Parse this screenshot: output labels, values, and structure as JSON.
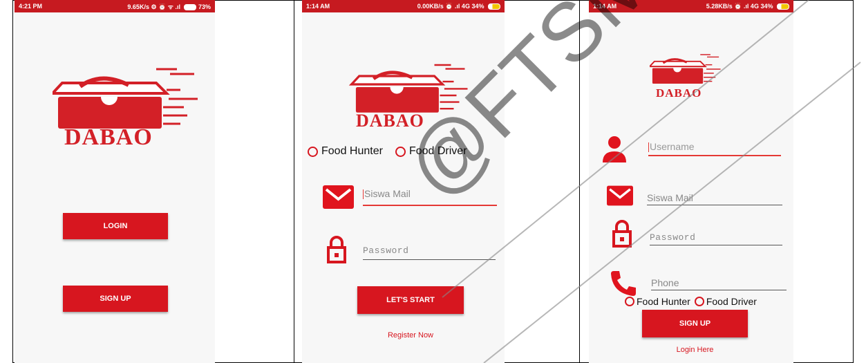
{
  "colors": {
    "accent": "#d7161f",
    "status_bar": "#c61a20",
    "panel_bg": "#f7f7f7"
  },
  "brand_name": "DABAO",
  "screens": [
    {
      "status": {
        "time": "4:21 PM",
        "right": "9.65K/s ⚙ ⏰ ᯤ .ıl",
        "battery": "73%"
      },
      "login_label": "LOGIN",
      "signup_label": "SIGN UP"
    },
    {
      "status": {
        "time": "1:14 AM",
        "right": "0.00KB/s ⏰ .ıl 4G",
        "battery": "34%"
      },
      "radio_hunter": "Food Hunter",
      "radio_driver": "Food Driver",
      "mail_placeholder": "Siswa Mail",
      "password_placeholder": "Password",
      "start_label": "LET'S START",
      "register_label": "Register Now"
    },
    {
      "status": {
        "time": "1:14 AM",
        "right": "5.28KB/s ⏰ .ıl 4G",
        "battery": "34%"
      },
      "username_placeholder": "Username",
      "mail_placeholder": "Siswa Mail",
      "password_placeholder": "Password",
      "phone_placeholder": "Phone",
      "radio_hunter": "Food Hunter",
      "radio_driver": "Food Driver",
      "signup_label": "SIGN UP",
      "login_link": "Login Here"
    }
  ],
  "watermark": "@FTSM"
}
